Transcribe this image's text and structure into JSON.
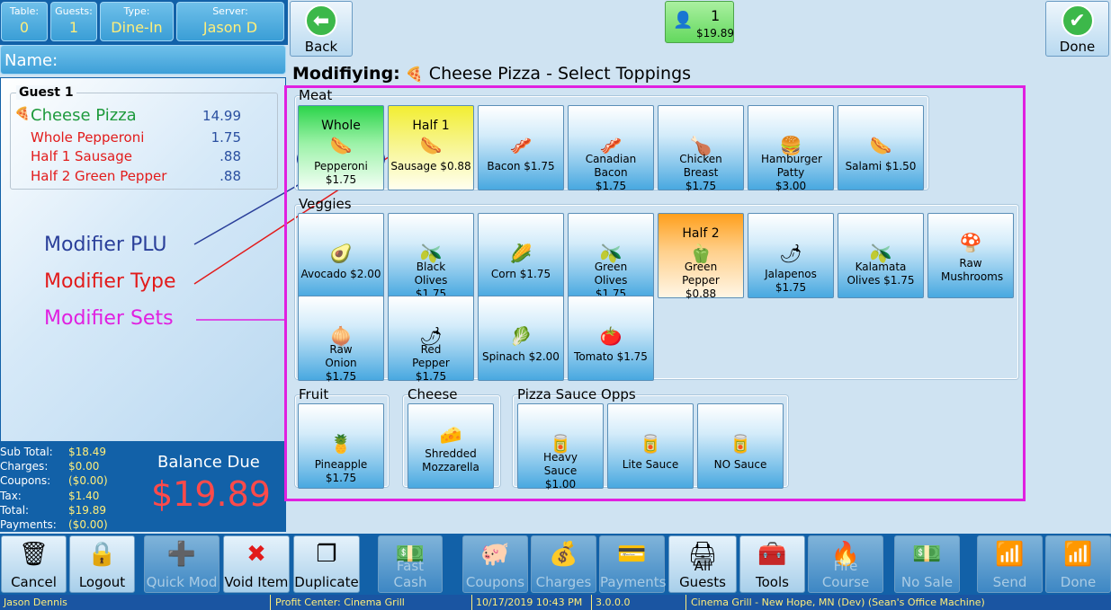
{
  "header": {
    "table": {
      "label": "Table:",
      "value": "0"
    },
    "guests": {
      "label": "Guests:",
      "value": "1"
    },
    "type": {
      "label": "Type:",
      "value": "Dine-In"
    },
    "server": {
      "label": "Server:",
      "value": "Jason D"
    },
    "name_label": "Name:"
  },
  "guest": {
    "title": "Guest 1",
    "lines": [
      {
        "name": "Cheese Pizza",
        "price": "14.99"
      },
      {
        "name": "Whole Pepperoni",
        "price": "1.75"
      },
      {
        "name": "Half 1 Sausage",
        "price": ".88"
      },
      {
        "name": "Half 2 Green Pepper",
        "price": ".88"
      }
    ]
  },
  "legend": {
    "plu": "Modifier PLU",
    "type": "Modifier Type",
    "sets": "Modifier Sets"
  },
  "totals": {
    "rows": [
      {
        "label": "Sub Total:",
        "value": "$18.49"
      },
      {
        "label": "Charges:",
        "value": "$0.00"
      },
      {
        "label": "Coupons:",
        "value": "($0.00)"
      },
      {
        "label": "Tax:",
        "value": "$1.40"
      },
      {
        "label": "Total:",
        "value": "$19.89"
      },
      {
        "label": "Payments:",
        "value": "($0.00)"
      }
    ],
    "balance_label": "Balance Due",
    "balance_value": "$19.89"
  },
  "toolbar": {
    "back": "Back",
    "done": "Done",
    "guest_count": "1",
    "guest_total": "$19.89"
  },
  "heading": {
    "prefix": "Modifiying:",
    "item": "Cheese Pizza",
    "suffix": "-  Select Toppings"
  },
  "groups": {
    "meat": "Meat",
    "veggies": "Veggies",
    "fruit": "Fruit",
    "cheese": "Cheese",
    "sauce": "Pizza Sauce Opps"
  },
  "meat": [
    {
      "top": "Whole",
      "name": "Pepperoni $1.75"
    },
    {
      "top": "Half 1",
      "name": "Sausage $0.88"
    },
    {
      "top": "",
      "name": "Bacon $1.75"
    },
    {
      "top": "",
      "name": "Canadian Bacon $1.75"
    },
    {
      "top": "",
      "name": "Chicken Breast $1.75"
    },
    {
      "top": "",
      "name": "Hamburger Patty $3.00"
    },
    {
      "top": "",
      "name": "Salami $1.50"
    }
  ],
  "veggies": [
    {
      "top": "",
      "name": "Avocado $2.00"
    },
    {
      "top": "",
      "name": "Black Olives $1.75"
    },
    {
      "top": "",
      "name": "Corn $1.75"
    },
    {
      "top": "",
      "name": "Green Olives $1.75"
    },
    {
      "top": "Half 2",
      "name": "Green Pepper $0.88"
    },
    {
      "top": "",
      "name": "Jalapenos $1.75"
    },
    {
      "top": "",
      "name": "Kalamata Olives $1.75"
    },
    {
      "top": "",
      "name": "Raw Mushrooms"
    },
    {
      "top": "",
      "name": "Raw Onion $1.75"
    },
    {
      "top": "",
      "name": "Red Pepper $1.75"
    },
    {
      "top": "",
      "name": "Spinach $2.00"
    },
    {
      "top": "",
      "name": "Tomato $1.75"
    }
  ],
  "fruit": [
    {
      "top": "",
      "name": "Pineapple $1.75"
    }
  ],
  "cheese": [
    {
      "top": "",
      "name": "Shredded Mozzarella"
    }
  ],
  "sauce": [
    {
      "top": "",
      "name": "Heavy Sauce $1.00"
    },
    {
      "top": "",
      "name": "Lite Sauce"
    },
    {
      "top": "",
      "name": "NO Sauce"
    }
  ],
  "bottom": {
    "cancel": "Cancel",
    "logout": "Logout",
    "quick_mod": "Quick Mod",
    "void_item": "Void Item",
    "duplicate": "Duplicate",
    "fast_cash": "Fast Cash",
    "coupons": "Coupons",
    "charges": "Charges",
    "payments": "Payments",
    "all_guests": "All Guests",
    "tools": "Tools",
    "fire_course": "Fire Course",
    "no_sale": "No Sale",
    "send": "Send",
    "done": "Done"
  },
  "status": {
    "user": "Jason Dennis",
    "profit_center": "Profit Center: Cinema Grill",
    "datetime": "10/17/2019 10:43 PM",
    "version": "3.0.0.0",
    "location": "Cinema Grill - New Hope, MN (Dev) (Sean's Office Machine)"
  },
  "colors": {
    "accent": "#1261a8",
    "highlight": "#ffee7a",
    "frame": "#e020e0",
    "whole": "#2bd44a",
    "half1": "#f2ee32",
    "half2": "#ff9f1c"
  }
}
